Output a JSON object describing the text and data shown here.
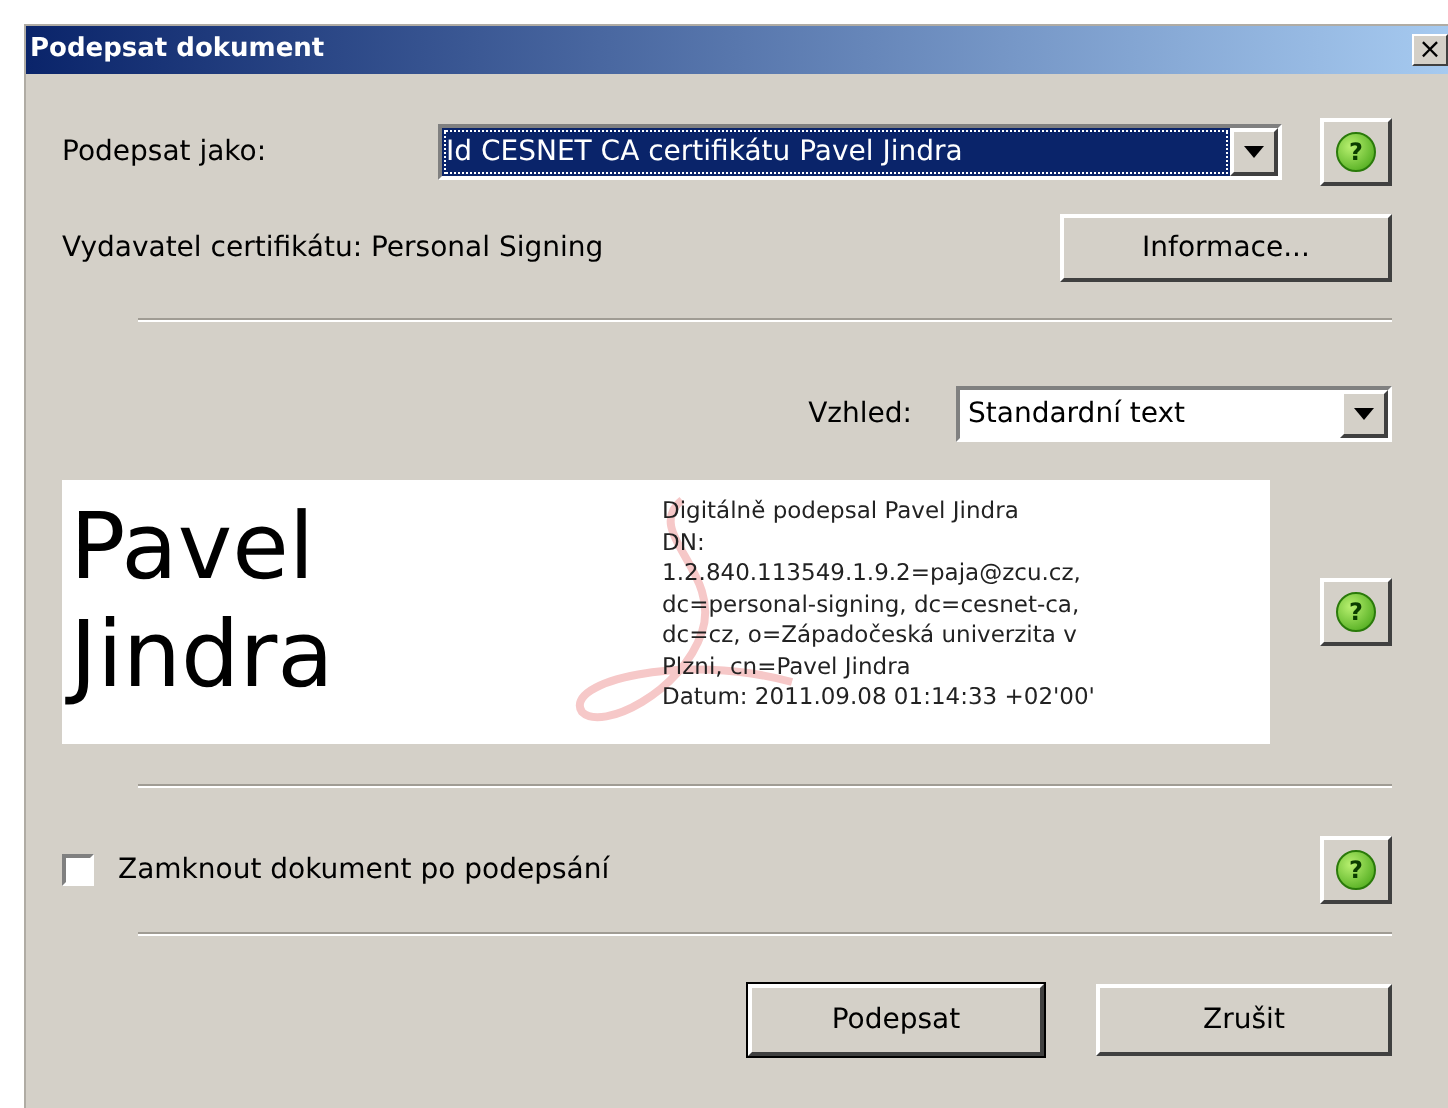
{
  "window": {
    "title": "Podepsat dokument",
    "close": "×"
  },
  "sign_as": {
    "label": "Podepsat jako:",
    "value": "Id CESNET CA certifikátu Pavel Jindra",
    "focused": true,
    "help": "?"
  },
  "issuer": {
    "label": "Vydavatel certifikátu: Personal Signing",
    "button": "Informace..."
  },
  "appearance": {
    "label": "Vzhled:",
    "value": "Standardní text"
  },
  "preview": {
    "name_lines": [
      "Pavel",
      "Jindra"
    ],
    "details": [
      "Digitálně podepsal Pavel Jindra",
      "DN:",
      "1.2.840.113549.1.9.2=paja@zcu.cz,",
      "dc=personal-signing, dc=cesnet-ca,",
      "dc=cz, o=Západočeská univerzita v",
      "Plzni, cn=Pavel Jindra",
      "Datum: 2011.09.08 01:14:33 +02'00'"
    ],
    "help": "?"
  },
  "lock": {
    "label": "Zamknout dokument po podepsání",
    "checked": false,
    "help": "?"
  },
  "buttons": [
    {
      "label": "Podepsat",
      "default": true
    },
    {
      "label": "Zrušit",
      "default": false
    }
  ]
}
